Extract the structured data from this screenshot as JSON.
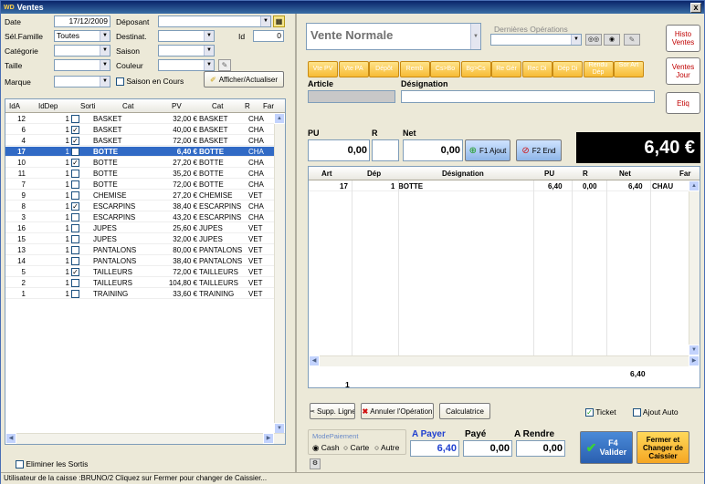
{
  "window": {
    "title": "Ventes",
    "close_label": "x"
  },
  "filters": {
    "date_label": "Date",
    "date_value": "17/12/2009",
    "deposant_label": "Déposant",
    "deposant_value": "",
    "famille_label": "Sél.Famille",
    "famille_value": "Toutes",
    "destinat_label": "Destinat.",
    "destinat_value": "",
    "id_label": "Id",
    "id_value": "0",
    "categorie_label": "Catégorie",
    "categorie_value": "",
    "saison_label": "Saison",
    "saison_value": "",
    "taille_label": "Taille",
    "taille_value": "",
    "couleur_label": "Couleur",
    "couleur_value": "",
    "marque_label": "Marque",
    "marque_value": "",
    "saison_cours_label": "Saison en Cours",
    "afficher_label": "Afficher/Actualiser"
  },
  "left_grid": {
    "columns": [
      "IdA",
      "IdDep",
      "Sorti",
      "Cat",
      "PV",
      "Cat",
      "R",
      "Far"
    ],
    "rows": [
      {
        "ida": "12",
        "iddep": "1",
        "sorti": false,
        "cat": "BASKET",
        "pv": "32,00 €",
        "cat2": "BASKET",
        "r": "CHA",
        "sel": false
      },
      {
        "ida": "6",
        "iddep": "1",
        "sorti": true,
        "cat": "BASKET",
        "pv": "40,00 €",
        "cat2": "BASKET",
        "r": "CHA",
        "sel": false
      },
      {
        "ida": "4",
        "iddep": "1",
        "sorti": true,
        "cat": "BASKET",
        "pv": "72,00 €",
        "cat2": "BASKET",
        "r": "CHA",
        "sel": false
      },
      {
        "ida": "17",
        "iddep": "1",
        "sorti": false,
        "cat": "BOTTE",
        "pv": "6,40 €",
        "cat2": "BOTTE",
        "r": "CHA",
        "sel": true
      },
      {
        "ida": "10",
        "iddep": "1",
        "sorti": true,
        "cat": "BOTTE",
        "pv": "27,20 €",
        "cat2": "BOTTE",
        "r": "CHA",
        "sel": false
      },
      {
        "ida": "11",
        "iddep": "1",
        "sorti": false,
        "cat": "BOTTE",
        "pv": "35,20 €",
        "cat2": "BOTTE",
        "r": "CHA",
        "sel": false
      },
      {
        "ida": "7",
        "iddep": "1",
        "sorti": false,
        "cat": "BOTTE",
        "pv": "72,00 €",
        "cat2": "BOTTE",
        "r": "CHA",
        "sel": false
      },
      {
        "ida": "9",
        "iddep": "1",
        "sorti": false,
        "cat": "CHEMISE",
        "pv": "27,20 €",
        "cat2": "CHEMISE",
        "r": "VET",
        "sel": false
      },
      {
        "ida": "8",
        "iddep": "1",
        "sorti": true,
        "cat": "ESCARPINS",
        "pv": "38,40 €",
        "cat2": "ESCARPINS",
        "r": "CHA",
        "sel": false
      },
      {
        "ida": "3",
        "iddep": "1",
        "sorti": false,
        "cat": "ESCARPINS",
        "pv": "43,20 €",
        "cat2": "ESCARPINS",
        "r": "CHA",
        "sel": false
      },
      {
        "ida": "16",
        "iddep": "1",
        "sorti": false,
        "cat": "JUPES",
        "pv": "25,60 €",
        "cat2": "JUPES",
        "r": "VET",
        "sel": false
      },
      {
        "ida": "15",
        "iddep": "1",
        "sorti": false,
        "cat": "JUPES",
        "pv": "32,00 €",
        "cat2": "JUPES",
        "r": "VET",
        "sel": false
      },
      {
        "ida": "13",
        "iddep": "1",
        "sorti": false,
        "cat": "PANTALONS",
        "pv": "80,00 €",
        "cat2": "PANTALONS",
        "r": "VET",
        "sel": false
      },
      {
        "ida": "14",
        "iddep": "1",
        "sorti": false,
        "cat": "PANTALONS",
        "pv": "38,40 €",
        "cat2": "PANTALONS",
        "r": "VET",
        "sel": false
      },
      {
        "ida": "5",
        "iddep": "1",
        "sorti": true,
        "cat": "TAILLEURS",
        "pv": "72,00 €",
        "cat2": "TAILLEURS",
        "r": "VET",
        "sel": false
      },
      {
        "ida": "2",
        "iddep": "1",
        "sorti": false,
        "cat": "TAILLEURS",
        "pv": "104,80 €",
        "cat2": "TAILLEURS",
        "r": "VET",
        "sel": false
      },
      {
        "ida": "1",
        "iddep": "1",
        "sorti": false,
        "cat": "TRAINING",
        "pv": "33,60 €",
        "cat2": "TRAINING",
        "r": "VET",
        "sel": false
      }
    ]
  },
  "eliminer_label": "Eliminer les Sortis",
  "sale": {
    "type_value": "Vente Normale",
    "dernieres_label": "Dernières Opérations",
    "op_buttons": [
      "Vte PV",
      "Vte PA",
      "Dépôt",
      "Remb",
      "Cs>Bo",
      "Bg>Cs",
      "Re Gér",
      "Rec Di",
      "Dép Di",
      "Rendu Dép",
      "Sor Art"
    ],
    "article_label": "Article",
    "designation_label": "Désignation",
    "pu_label": "PU",
    "r_label": "R",
    "net_label": "Net",
    "pu_value": "0,00",
    "net_value": "0,00",
    "ajout_label": "F1 Ajout",
    "end_label": "F2 End",
    "total_display": "6,40 €",
    "histo_label": "Histo Ventes",
    "ventes_jour_label": "Ventes Jour",
    "etiq_label": "Etiq"
  },
  "sale_grid": {
    "columns": [
      "Art",
      "Dép",
      "Désignation",
      "PU",
      "R",
      "Net",
      "Far"
    ],
    "rows": [
      {
        "art": "17",
        "dep": "1",
        "designation": "BOTTE",
        "pu": "6,40",
        "r": "0,00",
        "net": "6,40",
        "far": "CHAU"
      }
    ],
    "total_net": "6,40",
    "count": "1"
  },
  "actions": {
    "supp_label": "Supp. Ligne",
    "annuler_label": "Annuler l'Opération",
    "calc_label": "Calculatrice",
    "ticket_label": "Ticket",
    "ajout_auto_label": "Ajout Auto",
    "mode_paiement_label": "ModePaiement",
    "cash_label": "Cash",
    "carte_label": "Carte",
    "autre_label": "Autre",
    "a_payer_label": "A Payer",
    "paye_label": "Payé",
    "a_rendre_label": "A Rendre",
    "a_payer_value": "6,40",
    "paye_value": "0,00",
    "a_rendre_value": "0,00",
    "valider_label": "F4 Valider",
    "fermer_label": "Fermer et Changer de Caissier"
  },
  "status_text": "Utilisateur de la caisse :BRUNO/2   Cliquez sur Fermer pour changer de Caissier...",
  "colors": {
    "selected_row": "#316ac5",
    "op_orange": "#f7bb35",
    "valider_green": "#3a9f3a",
    "danger_red": "#c00000"
  }
}
